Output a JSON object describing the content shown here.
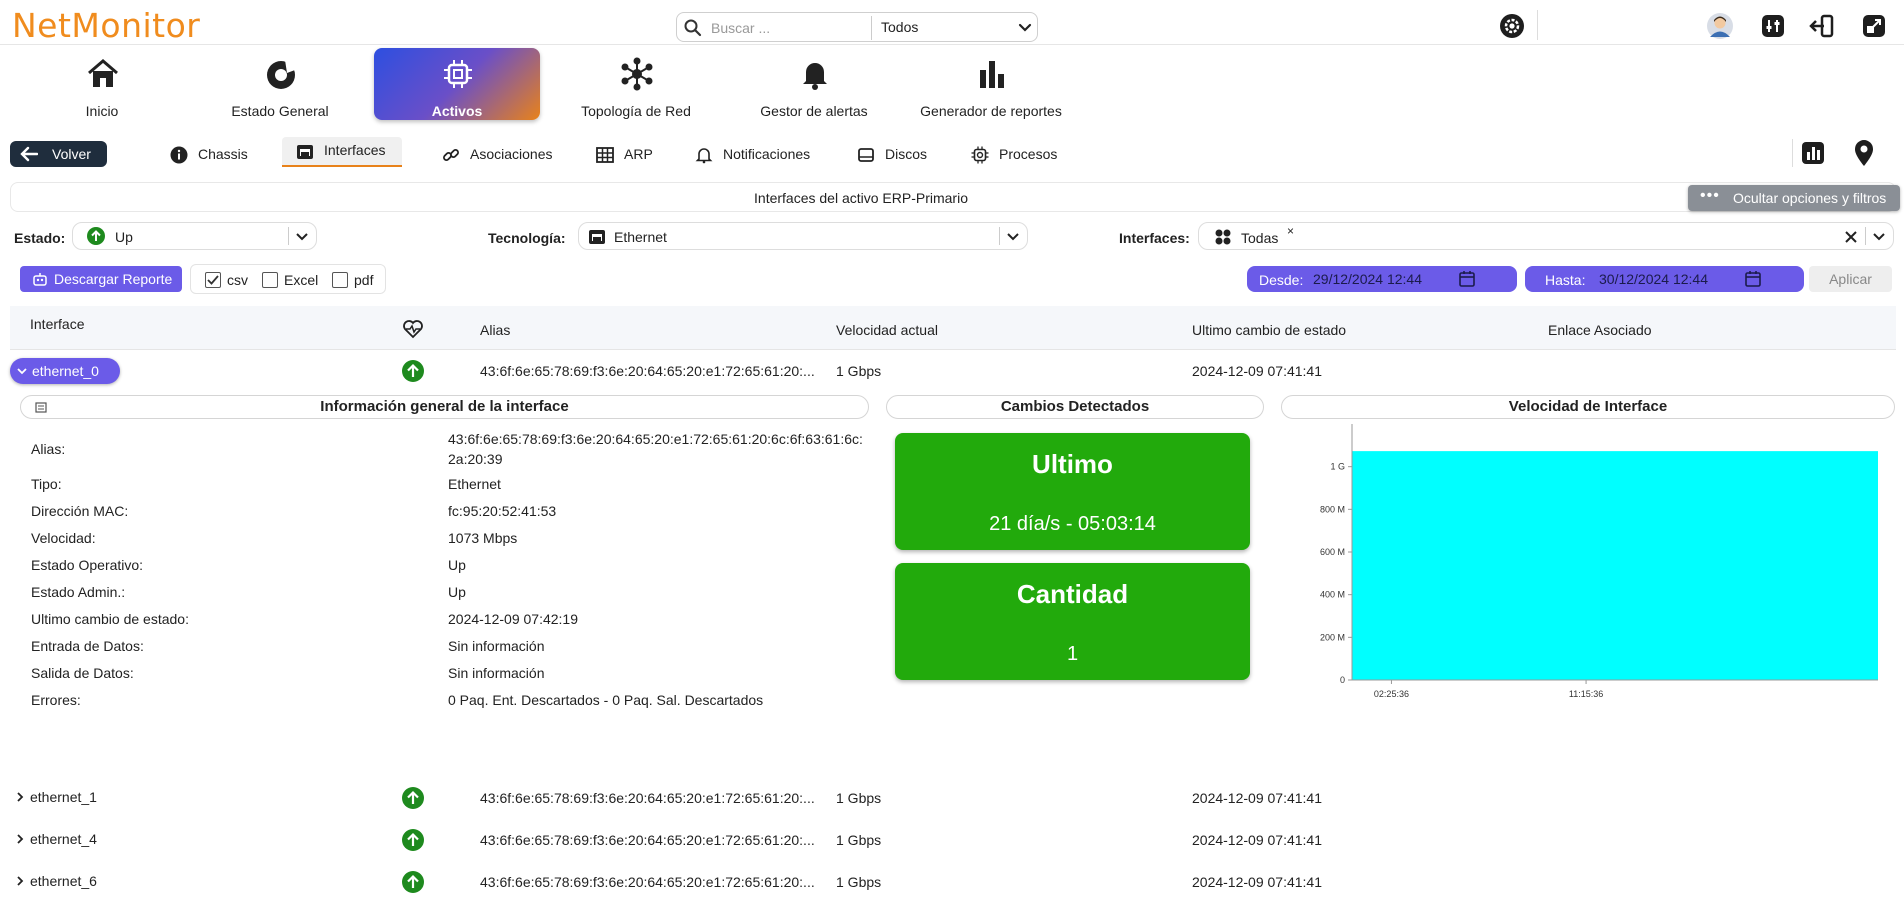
{
  "app": {
    "logo": "NetMonitor"
  },
  "search": {
    "placeholder": "Buscar ...",
    "value": "",
    "scope": "Todos"
  },
  "nav": [
    {
      "label": "Inicio",
      "icon": "home-icon"
    },
    {
      "label": "Estado General",
      "icon": "gauge-icon"
    },
    {
      "label": "Activos",
      "icon": "chip-icon",
      "active": true
    },
    {
      "label": "Topología de Red",
      "icon": "network-icon"
    },
    {
      "label": "Gestor de alertas",
      "icon": "bell-icon"
    },
    {
      "label": "Generador de reportes",
      "icon": "bar-chart-icon"
    }
  ],
  "subnav": {
    "back_label": "Volver",
    "tabs": [
      {
        "label": "Chassis",
        "icon": "info-icon"
      },
      {
        "label": "Interfaces",
        "icon": "ethernet-icon",
        "active": true
      },
      {
        "label": "Asociaciones",
        "icon": "link-icon"
      },
      {
        "label": "ARP",
        "icon": "table-icon"
      },
      {
        "label": "Notificaciones",
        "icon": "bell-icon"
      },
      {
        "label": "Discos",
        "icon": "disk-icon"
      },
      {
        "label": "Procesos",
        "icon": "cpu-icon"
      }
    ]
  },
  "title": "Interfaces del activo ERP-Primario",
  "filters_toggle_label": "Ocultar opciones y filtros",
  "filters": {
    "estado_label": "Estado:",
    "estado_value": "Up",
    "tecnologia_label": "Tecnología:",
    "tecnologia_value": "Ethernet",
    "interfaces_label": "Interfaces:",
    "interfaces_value": "Todas",
    "chip_remove": "×"
  },
  "report": {
    "download_label": "Descargar Reporte",
    "formats": [
      {
        "label": "csv",
        "checked": true
      },
      {
        "label": "Excel",
        "checked": false
      },
      {
        "label": "pdf",
        "checked": false
      }
    ],
    "desde_label": "Desde:",
    "desde_value": "29/12/2024 12:44",
    "hasta_label": "Hasta:",
    "hasta_value": "30/12/2024 12:44",
    "apply_label": "Aplicar"
  },
  "table": {
    "columns": [
      "Interface",
      "Alias",
      "Velocidad actual",
      "Ultimo cambio de estado",
      "Enlace Asociado"
    ],
    "rows": [
      {
        "name": "ethernet_0",
        "alias": "43:6f:6e:65:78:69:f3:6e:20:64:65:20:e1:72:65:61:20:...",
        "speed": "1 Gbps",
        "last_change": "2024-12-09 07:41:41",
        "link": ""
      },
      {
        "name": "ethernet_1",
        "alias": "43:6f:6e:65:78:69:f3:6e:20:64:65:20:e1:72:65:61:20:...",
        "speed": "1 Gbps",
        "last_change": "2024-12-09 07:41:41",
        "link": ""
      },
      {
        "name": "ethernet_4",
        "alias": "43:6f:6e:65:78:69:f3:6e:20:64:65:20:e1:72:65:61:20:...",
        "speed": "1 Gbps",
        "last_change": "2024-12-09 07:41:41",
        "link": ""
      },
      {
        "name": "ethernet_6",
        "alias": "43:6f:6e:65:78:69:f3:6e:20:64:65:20:e1:72:65:61:20:...",
        "speed": "1 Gbps",
        "last_change": "2024-12-09 07:41:41",
        "link": ""
      }
    ]
  },
  "detail": {
    "info_title": "Información general de la interface",
    "changes_title": "Cambios Detectados",
    "speed_title": "Velocidad de Interface",
    "info": [
      {
        "k": "Alias:",
        "v": "43:6f:6e:65:78:69:f3:6e:20:64:65:20:e1:72:65:61:20:6c:6f:63:61:6c:",
        "v2": "2a:20:39"
      },
      {
        "k": "Tipo:",
        "v": "Ethernet"
      },
      {
        "k": "Dirección MAC:",
        "v": "fc:95:20:52:41:53"
      },
      {
        "k": "Velocidad:",
        "v": "1073 Mbps"
      },
      {
        "k": "Estado Operativo:",
        "v": "Up"
      },
      {
        "k": "Estado Admin.:",
        "v": "Up"
      },
      {
        "k": "Ultimo cambio de estado:",
        "v": "2024-12-09 07:42:19"
      },
      {
        "k": "Entrada de Datos:",
        "v": "Sin información"
      },
      {
        "k": "Salida de Datos:",
        "v": "Sin información"
      },
      {
        "k": "Errores:",
        "v": "0 Paq. Ent. Descartados - 0 Paq. Sal. Descartados"
      }
    ],
    "cards": [
      {
        "title": "Ultimo",
        "value": "21 día/s - 05:03:14"
      },
      {
        "title": "Cantidad",
        "value": "1"
      }
    ]
  },
  "colors": {
    "accent": "#6b5be8",
    "logo": "#f08c1e",
    "success": "#22aa0c",
    "status_up": "#1e8a1e",
    "chart_fill": "#00ffff"
  },
  "chart_data": {
    "type": "area",
    "title": "Velocidad de Interface",
    "x_ticks": [
      "02:25:36",
      "11:15:36"
    ],
    "y_ticks": [
      "0",
      "200 M",
      "400 M",
      "600 M",
      "800 M",
      "1 G"
    ],
    "ylim": [
      0,
      1200000000
    ],
    "x": [
      "02:25:36",
      "11:15:36"
    ],
    "series": [
      {
        "values": [
          1073000000,
          1073000000,
          1073000000
        ]
      }
    ],
    "grid": false,
    "legend": "none"
  }
}
